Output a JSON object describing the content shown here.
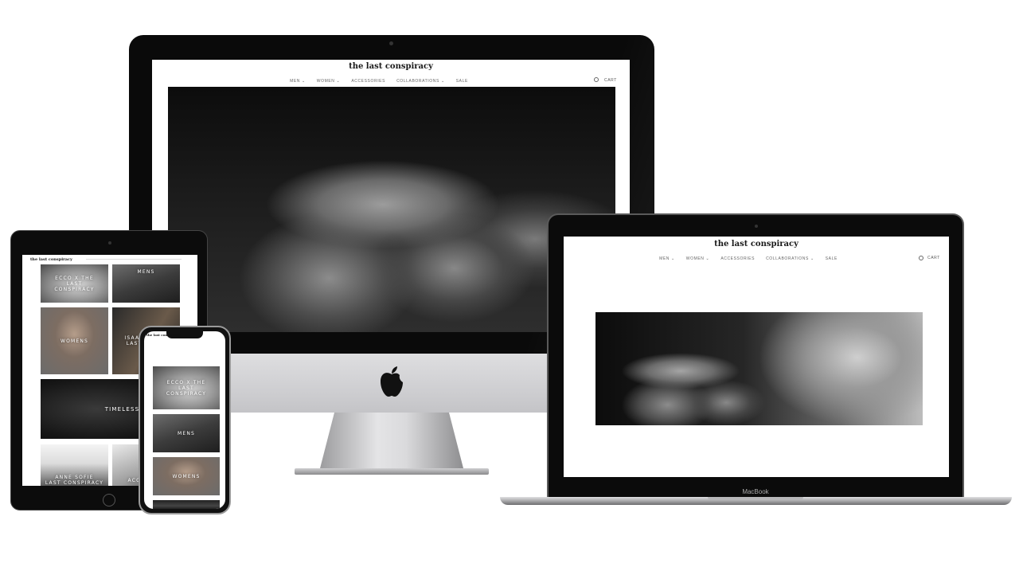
{
  "site": {
    "title": "the last conspiracy",
    "nav": [
      "MEN",
      "WOMEN",
      "ACCESSORIES",
      "COLLABORATIONS",
      "SALE"
    ],
    "nav_dropdown_marker": "⌄",
    "cart_label": "CART"
  },
  "tiles": {
    "ecco": "ECCO X THE LAST CONSPIRACY",
    "mens": "MENS",
    "womens": "WOMENS",
    "isaac_partial": "ISAAC\nLAST",
    "timeless": "TIMELESS",
    "anne_partial": "ANNE SOFIE\nLAST CONSPIRACY",
    "acc_partial": "ACC"
  },
  "laptop": {
    "brand": "MacBook"
  },
  "colors": {
    "bezel": "#0a0a0a",
    "aluminum": "#c9c9cc",
    "page_bg": "#ffffff"
  },
  "icons": {
    "imac_logo": "apple-logo-icon",
    "search": "search-icon"
  }
}
